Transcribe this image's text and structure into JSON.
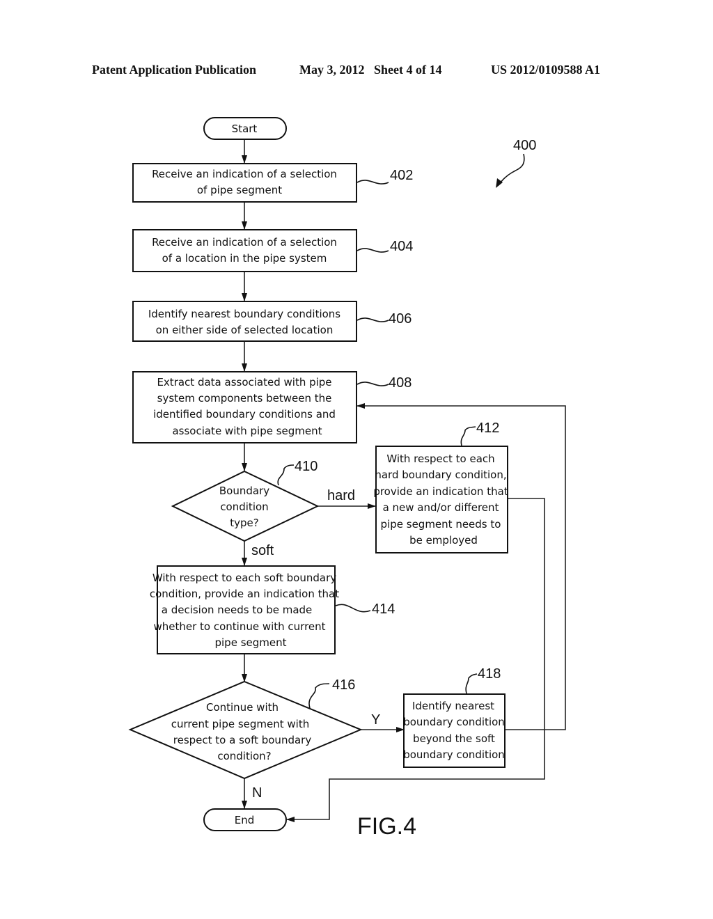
{
  "header": {
    "publication": "Patent Application Publication",
    "date_sheet": "May 3, 2012   Sheet 4 of 14",
    "number": "US 2012/0109588 A1"
  },
  "figure": {
    "label": "FIG.4",
    "ref": "400"
  },
  "nodes": {
    "start": {
      "text": "Start"
    },
    "n402": {
      "ref": "402",
      "lines": [
        "Receive an indication of a selection",
        "of pipe segment"
      ]
    },
    "n404": {
      "ref": "404",
      "lines": [
        "Receive an indication of a selection",
        "of a location in the pipe system"
      ]
    },
    "n406": {
      "ref": "406",
      "lines": [
        "Identify nearest boundary conditions",
        "on either side of selected location"
      ]
    },
    "n408": {
      "ref": "408",
      "lines": [
        "Extract data associated with pipe",
        "system components between the",
        "identified boundary conditions and",
        "associate with pipe segment"
      ]
    },
    "n410": {
      "ref": "410",
      "lines": [
        "Boundary",
        "condition",
        "type?"
      ]
    },
    "n412": {
      "ref": "412",
      "lines": [
        "With respect to each",
        "hard boundary condition,",
        "provide an indication that",
        "a new and/or different",
        "pipe segment needs to",
        "be employed"
      ]
    },
    "n414": {
      "ref": "414",
      "lines": [
        "With respect to each soft boundary",
        "condition, provide an indication that",
        "a decision needs to be made",
        "whether to continue with current",
        "pipe segment"
      ]
    },
    "n416": {
      "ref": "416",
      "lines": [
        "Continue with",
        "current pipe segment with",
        "respect to a soft boundary",
        "condition?"
      ]
    },
    "n418": {
      "ref": "418",
      "lines": [
        "Identify nearest",
        "boundary condition",
        "beyond the soft",
        "boundary condition"
      ]
    },
    "end": {
      "text": "End"
    }
  },
  "edge_labels": {
    "hard": "hard",
    "soft": "soft",
    "yes": "Y",
    "no": "N"
  }
}
